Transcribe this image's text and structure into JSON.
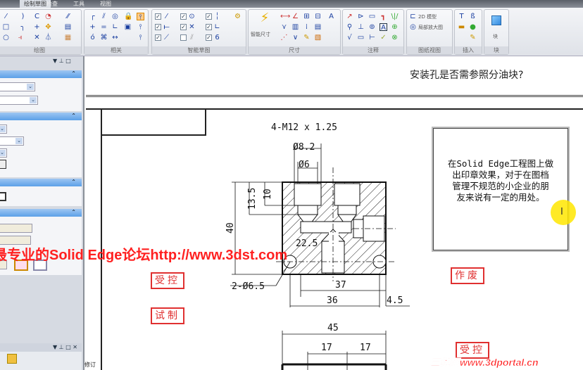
{
  "ribbon": {
    "tabs": [
      "绘制草图",
      "检查",
      "工具",
      "视图"
    ],
    "groups": [
      "绘图",
      "相关",
      "智能草图",
      "尺寸",
      "注释",
      "图纸视图",
      "插入",
      "块"
    ],
    "smart_dimension_label": "智能尺寸",
    "model_2d_label": "2D 模型",
    "detail_view_label": "局部放大图",
    "block_label": "块"
  },
  "canvas": {
    "question": "安装孔是否需参照分油块?",
    "note_text": [
      "在Solid Edge工程图上做",
      "出印章效果，对于在图档",
      "管理不规范的小企业的朋",
      "友来说有一定的用处。"
    ],
    "cursor": "I",
    "stamps": {
      "controlled_1": "受控",
      "trial": "试制",
      "obsolete": "作废",
      "controlled_2": "受控"
    },
    "dims": {
      "thread": "4-M12 x 1.25",
      "d82": "Ø8.2",
      "d6": "Ø6",
      "h135": "13.5",
      "h10": "10",
      "h40": "40",
      "d225": "22.5",
      "holes": "2-Ø6.5",
      "w37": "37",
      "w36": "36",
      "w45e": "4.5",
      "w45": "45",
      "w17a": "17",
      "w17b": "17"
    }
  },
  "watermarks": {
    "forum": "最专业的Solid Edge论坛http://www.3dst.com",
    "portal": "三维网www.3dportal.cn"
  },
  "leftpanel": {
    "bottom_label": "修订"
  }
}
